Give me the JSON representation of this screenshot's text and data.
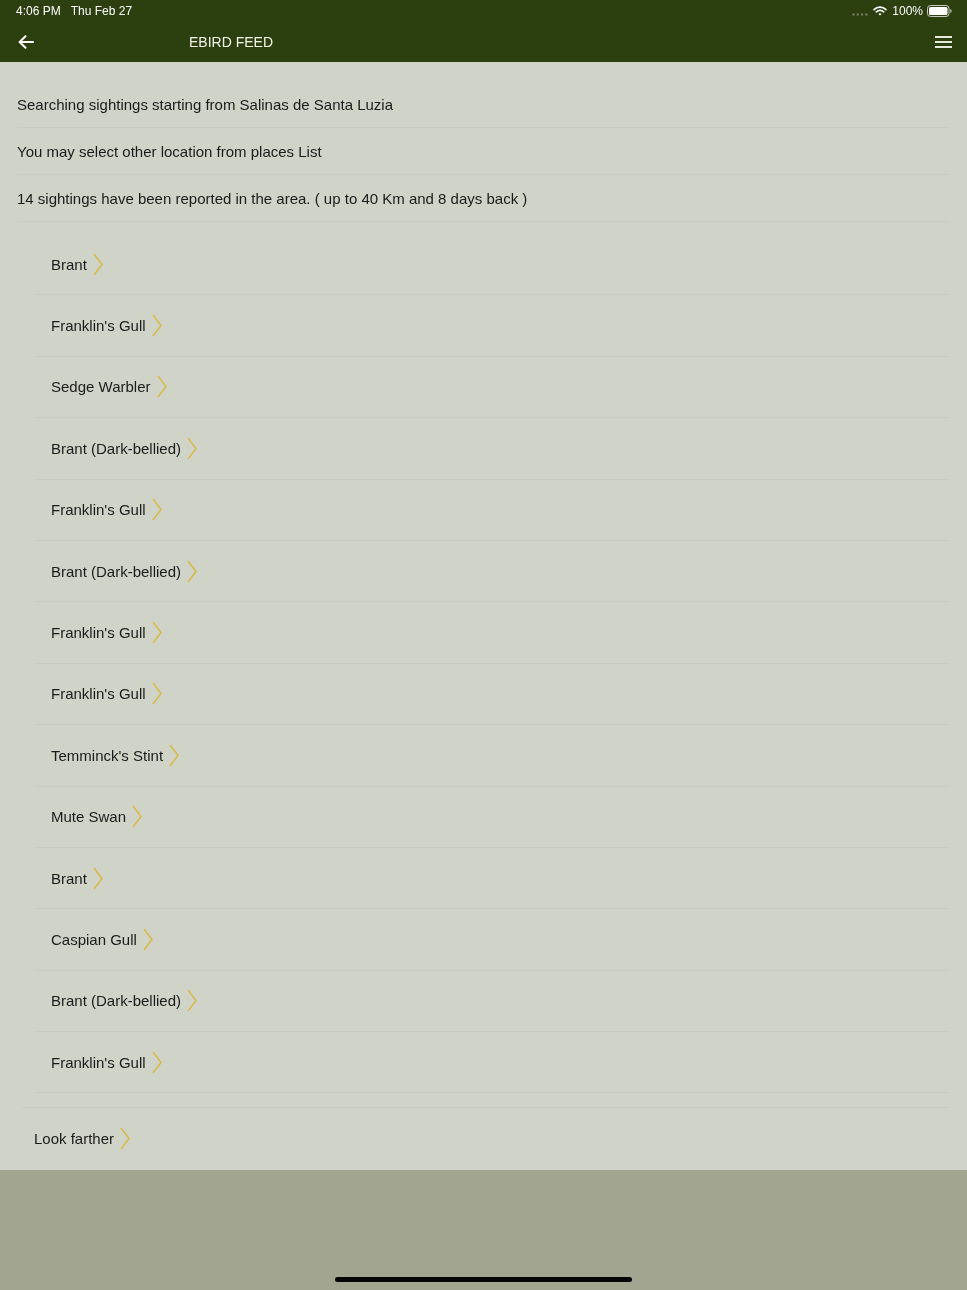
{
  "status_bar": {
    "time": "4:06 PM",
    "date": "Thu Feb 27",
    "battery": "100%"
  },
  "header": {
    "title": "EBIRD FEED"
  },
  "info_lines": [
    "Searching sightings starting from Salinas de Santa Luzia",
    "You may select other location from places List",
    "14 sightings have been reported in the area. ( up to 40 Km and 8 days back )"
  ],
  "sightings": [
    "Brant",
    "Franklin's Gull",
    "Sedge Warbler",
    "Brant (Dark-bellied)",
    "Franklin's Gull",
    "Brant (Dark-bellied)",
    "Franklin's Gull",
    "Franklin's Gull",
    "Temminck's Stint",
    "Mute Swan",
    "Brant",
    "Caspian Gull",
    "Brant (Dark-bellied)",
    "Franklin's Gull"
  ],
  "more_link": {
    "label": "Look farther"
  }
}
